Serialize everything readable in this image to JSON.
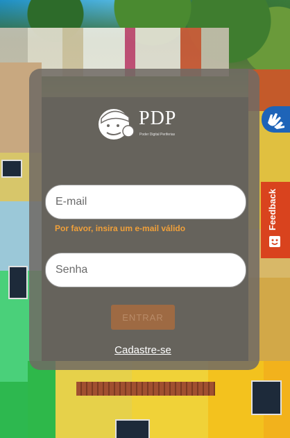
{
  "brand": {
    "name": "PDP",
    "tagline": "Poder Digital Periferias"
  },
  "login_form": {
    "email_placeholder": "E-mail",
    "email_error": "Por favor, insira um e-mail válido",
    "password_placeholder": "Senha",
    "submit_label": "ENTRAR",
    "signup_link": "Cadastre-se"
  },
  "side_widgets": {
    "accessibility_icon": "sign-language-hands-icon",
    "feedback_label": "Feedback",
    "feedback_icon": "smile-face-icon"
  },
  "colors": {
    "card_background": "#706a64",
    "error_text": "#f0a03a",
    "submit_button": "#9e6a43",
    "accessibility_tab": "#1e64b8",
    "feedback_tab": "#d9431e"
  }
}
